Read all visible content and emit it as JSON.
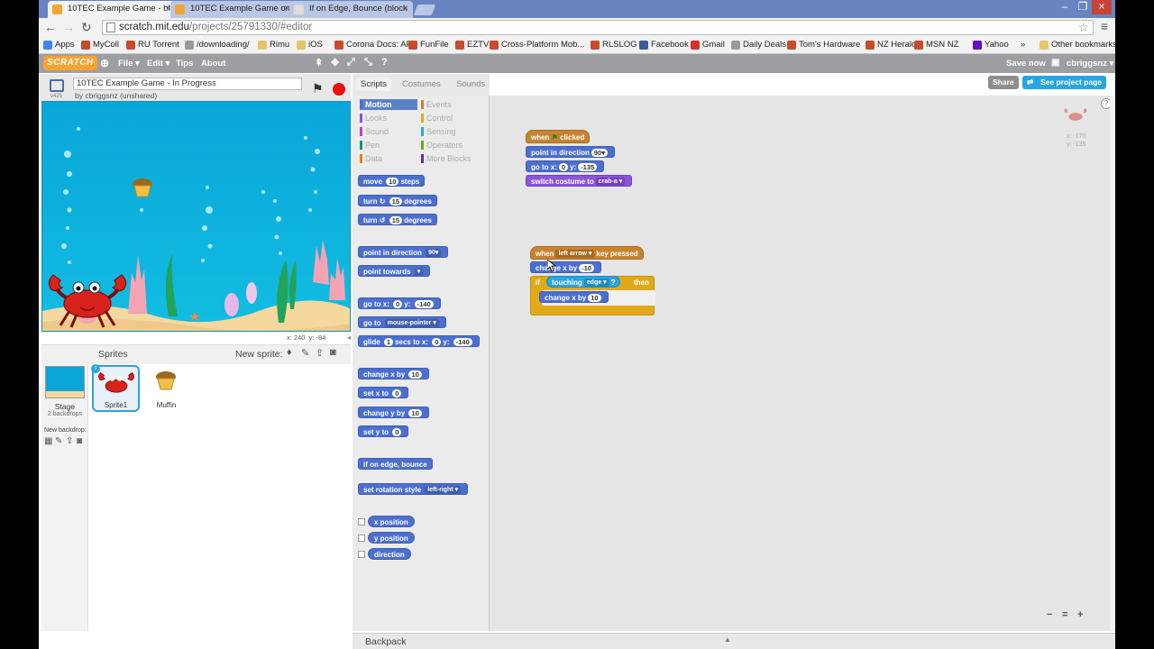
{
  "browser": {
    "tabs": [
      {
        "title": "10TEC Example Game - bl",
        "active": true
      },
      {
        "title": "10TEC Example Game on ",
        "active": false
      },
      {
        "title": "If on Edge, Bounce (block",
        "active": false
      }
    ],
    "url_host": "scratch.mit.edu",
    "url_path": "/projects/25791330/#editor"
  },
  "bookmarks": [
    {
      "label": "Apps",
      "icon": "apps-icon"
    },
    {
      "label": "MyColl",
      "icon": "site-icon"
    },
    {
      "label": "RU Torrent",
      "icon": "site-icon"
    },
    {
      "label": "/downloading/",
      "icon": "page-icon"
    },
    {
      "label": "Rimu",
      "icon": "folder-icon"
    },
    {
      "label": "iOS",
      "icon": "folder-icon"
    },
    {
      "label": "Corona Docs: API",
      "icon": "site-icon"
    },
    {
      "label": "FunFile",
      "icon": "site-icon"
    },
    {
      "label": "EZTV",
      "icon": "site-icon"
    },
    {
      "label": "Cross-Platform Mob...",
      "icon": "site-icon"
    },
    {
      "label": "RLSLOG",
      "icon": "site-icon"
    },
    {
      "label": "Facebook",
      "icon": "facebook-icon"
    },
    {
      "label": "Gmail",
      "icon": "gmail-icon"
    },
    {
      "label": "Daily Deals",
      "icon": "page-icon"
    },
    {
      "label": "Tom's Hardware",
      "icon": "site-icon"
    },
    {
      "label": "NZ Herald",
      "icon": "site-icon"
    },
    {
      "label": "MSN NZ",
      "icon": "site-icon"
    },
    {
      "label": "Yahoo",
      "icon": "yahoo-icon"
    },
    {
      "label": "»",
      "icon": ""
    },
    {
      "label": "Other bookmarks",
      "icon": "folder-icon"
    }
  ],
  "scratch_menu": {
    "logo": "SCRATCH",
    "file": "File ▾",
    "edit": "Edit ▾",
    "tips": "Tips",
    "about": "About",
    "save_now": "Save now",
    "user": "cbriggsnz ▾"
  },
  "project": {
    "title": "10TEC Example Game - In Progress",
    "byline": "by cbriggsnz (unshared)",
    "version": "v425"
  },
  "stage": {
    "mouse_x": "x: 240",
    "mouse_y": "y: -84"
  },
  "sprites_pane": {
    "title": "Sprites",
    "new_sprite": "New sprite:",
    "stage_label": "Stage",
    "stage_sub": "2 backdrops",
    "new_backdrop": "New backdrop:",
    "sprites": [
      {
        "name": "Sprite1",
        "selected": true
      },
      {
        "name": "Muffin",
        "selected": false
      }
    ]
  },
  "tabs": {
    "scripts": "Scripts",
    "costumes": "Costumes",
    "sounds": "Sounds"
  },
  "top_right": {
    "share": "Share",
    "see_project": "See project page"
  },
  "categories": [
    {
      "label": "Motion",
      "color": "#4a6cd4",
      "selected": true
    },
    {
      "label": "Events",
      "color": "#c88330",
      "selected": false
    },
    {
      "label": "Looks",
      "color": "#8a55d7",
      "selected": false
    },
    {
      "label": "Control",
      "color": "#e1a91a",
      "selected": false
    },
    {
      "label": "Sound",
      "color": "#bb42c3",
      "selected": false
    },
    {
      "label": "Sensing",
      "color": "#2ca5e2",
      "selected": false
    },
    {
      "label": "Pen",
      "color": "#0e9a6c",
      "selected": false
    },
    {
      "label": "Operators",
      "color": "#5cb712",
      "selected": false
    },
    {
      "label": "Data",
      "color": "#ee7d16",
      "selected": false
    },
    {
      "label": "More Blocks",
      "color": "#632d99",
      "selected": false
    }
  ],
  "palette": {
    "move": [
      "move",
      "10",
      "steps"
    ],
    "turn_right": [
      "turn",
      "↻",
      "15",
      "degrees"
    ],
    "turn_left": [
      "turn",
      "↺",
      "15",
      "degrees"
    ],
    "point_dir": [
      "point in direction",
      "90▾"
    ],
    "point_towards": [
      "point towards",
      "▾"
    ],
    "goto_xy": [
      "go to x:",
      "0",
      "y:",
      "-140"
    ],
    "goto": [
      "go to",
      "mouse-pointer ▾"
    ],
    "glide": [
      "glide",
      "1",
      "secs to x:",
      "0",
      "y:",
      "-140"
    ],
    "change_x": [
      "change x by",
      "10"
    ],
    "set_x": [
      "set x to",
      "0"
    ],
    "change_y": [
      "change y by",
      "10"
    ],
    "set_y": [
      "set y to",
      "0"
    ],
    "bounce": "if on edge, bounce",
    "rot_style": [
      "set rotation style",
      "left-right ▾"
    ],
    "reporters": [
      "x position",
      "y position",
      "direction"
    ]
  },
  "script1": {
    "hat": [
      "when",
      "clicked"
    ],
    "point": [
      "point in direction",
      "90▾"
    ],
    "goto": [
      "go to x:",
      "0",
      "y:",
      "-135"
    ],
    "costume": [
      "switch costume to",
      "crab-a ▾"
    ]
  },
  "script2": {
    "hat": [
      "when",
      "left arrow ▾",
      "key pressed"
    ],
    "change": [
      "change x by",
      "-10"
    ],
    "if": [
      "if",
      "then"
    ],
    "touching": [
      "touching",
      "edge ▾",
      "?"
    ],
    "change2": [
      "change x by",
      "10"
    ]
  },
  "sprite_info": {
    "x": "x: -170",
    "y": "y: -135"
  },
  "backpack": "Backpack",
  "zoom": [
    "−",
    "=",
    "+"
  ]
}
